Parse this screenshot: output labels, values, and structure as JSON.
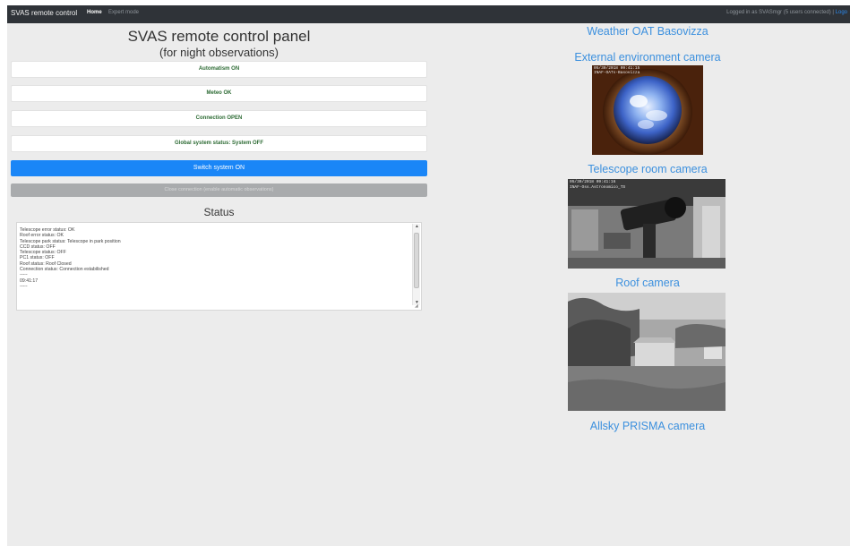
{
  "navbar": {
    "brand": "SVAS remote control",
    "home": "Home",
    "expert": "Expert mode",
    "user_text": "Logged in as SVASmgr (5 users connected)",
    "separator": "|",
    "logout": "Logo"
  },
  "panel": {
    "title": "SVAS remote control panel",
    "subtitle": "(for night observations)"
  },
  "indicators": [
    "Automatism ON",
    "Meteo OK",
    "Connection OPEN",
    "Global system status: System OFF"
  ],
  "buttons": {
    "switch_on": "Switch system ON",
    "close_connection": "Close connection (enable automatic observations)"
  },
  "status": {
    "title": "Status",
    "lines": [
      "Telescope error status: OK",
      "Roof error status: OK",
      "Telescope park status: Telescope in park position",
      "CCD status:  OFF",
      "Telescope status:  OFF",
      "PC1 status:  OFF",
      "Roof status:  Roof Closed",
      "Connection status: Connection estabilished",
      "-----",
      "09:41:17",
      "-----"
    ]
  },
  "cameras": {
    "weather": "Weather OAT Basovizza",
    "external": "External environment camera",
    "telescope": "Telescope room camera",
    "roof": "Roof camera",
    "allsky": "Allsky PRISMA camera"
  },
  "camera_overlays": {
    "external": [
      "05/30/2018 09:41:15",
      "INAF-OATs-Basovizza"
    ],
    "telescope": [
      "05/30/2018 09:41:16",
      "INAF-Oss.Astronomico_TS"
    ]
  }
}
